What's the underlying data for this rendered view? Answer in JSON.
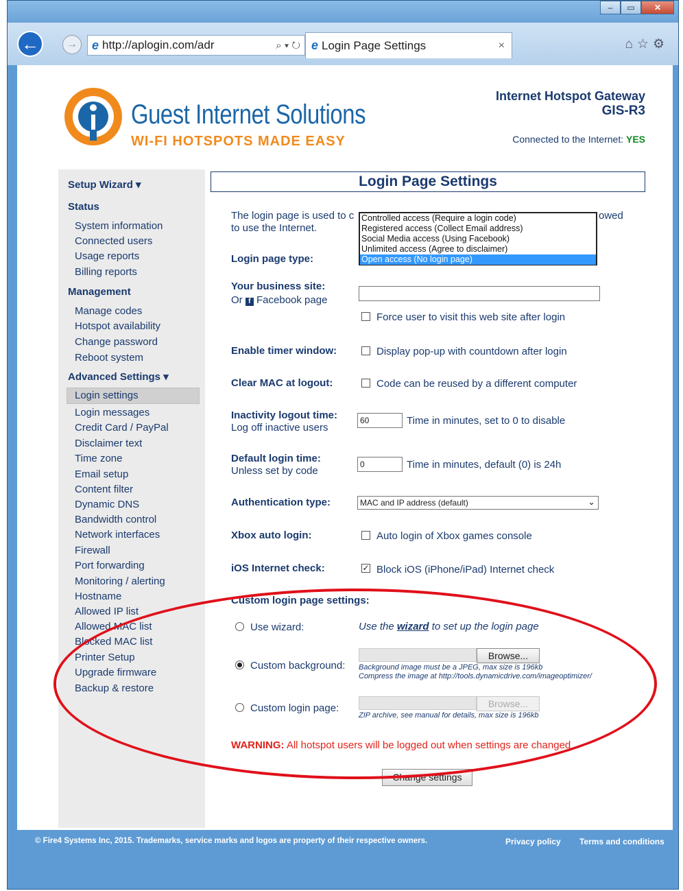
{
  "browser": {
    "url": "http://aplogin.com/adr",
    "tab_title": "Login Page Settings",
    "tab_close": "×",
    "window_controls": [
      "–",
      "▭",
      "✕"
    ]
  },
  "header": {
    "brand": "Guest Internet Solutions",
    "tagline": "WI-FI HOTSPOTS MADE EASY",
    "product": "Internet Hotspot Gateway",
    "model": "GIS-R3",
    "connected_label": "Connected to the Internet:",
    "connected_value": "YES"
  },
  "sidebar": {
    "setup_wizard": "Setup Wizard ▾",
    "status": "Status",
    "status_items": [
      "System information",
      "Connected users",
      "Usage reports",
      "Billing reports"
    ],
    "management": "Management",
    "management_items": [
      "Manage codes",
      "Hotspot availability",
      "Change password",
      "Reboot system"
    ],
    "advanced": "Advanced Settings ▾",
    "advanced_items": [
      "Login settings",
      "Login messages",
      "Credit Card / PayPal",
      "Disclaimer text",
      "Time zone",
      "Email setup",
      "Content filter",
      "Dynamic DNS",
      "Bandwidth control",
      "Network interfaces",
      "Firewall",
      "Port forwarding",
      "Monitoring / alerting",
      "Hostname",
      "Allowed IP list",
      "Allowed MAC list",
      "Blocked MAC list",
      "Printer Setup",
      "Upgrade firmware",
      "Backup & restore"
    ]
  },
  "main": {
    "title": "Login Page Settings",
    "intro_line1": "The login page is used to c",
    "intro_line1_end": "owed",
    "intro_line2": "to use the Internet.",
    "login_type_label": "Login page type:",
    "login_type_options": [
      "Controlled access (Require a login code)",
      "Registered access (Collect Email address)",
      "Social Media access (Using Facebook)",
      "Unlimited access (Agree to disclaimer)",
      "Open access (No login page)"
    ],
    "business_label": "Your business site:",
    "business_sub_prefix": "Or",
    "business_sub_suffix": "Facebook page",
    "business_value": "",
    "force_visit": "Force user to visit this web site after login",
    "timer_label": "Enable timer window:",
    "timer_text": "Display pop-up with countdown after login",
    "clearmac_label": "Clear MAC at logout:",
    "clearmac_text": "Code can be reused by a different computer",
    "inactivity_label": "Inactivity logout time:",
    "inactivity_sub": "Log off inactive users",
    "inactivity_value": "60",
    "inactivity_help": "Time in minutes, set to 0 to disable",
    "default_label": "Default login time:",
    "default_sub": "Unless set by code",
    "default_value": "0",
    "default_help": "Time in minutes, default (0) is 24h",
    "auth_label": "Authentication type:",
    "auth_value": "MAC and IP address (default)",
    "xbox_label": "Xbox auto login:",
    "xbox_text": "Auto login of Xbox games console",
    "ios_label": "iOS Internet check:",
    "ios_text": "Block iOS (iPhone/iPad) Internet check",
    "custom_heading": "Custom login page settings:",
    "use_wizard": "Use wizard:",
    "wizard_pre": "Use the",
    "wizard_link": "wizard",
    "wizard_post": "to set up the login page",
    "custom_bg": "Custom background:",
    "browse": "Browse...",
    "bg_note1": "Background image must be a JPEG, max size is 196kb",
    "bg_note2": "Compress the image at http://tools.dynamicdrive.com/imageoptimizer/",
    "custom_page": "Custom login page:",
    "page_note": "ZIP archive, see manual for details, max size is 196kb",
    "warning_bold": "WARNING:",
    "warning_text": "All hotspot users will be logged out when settings are changed",
    "submit": "Change settings"
  },
  "footer": {
    "copyright": "© Fire4 Systems Inc, 2015. Trademarks, service marks and logos are property of their respective owners.",
    "privacy": "Privacy policy",
    "terms": "Terms and conditions"
  }
}
